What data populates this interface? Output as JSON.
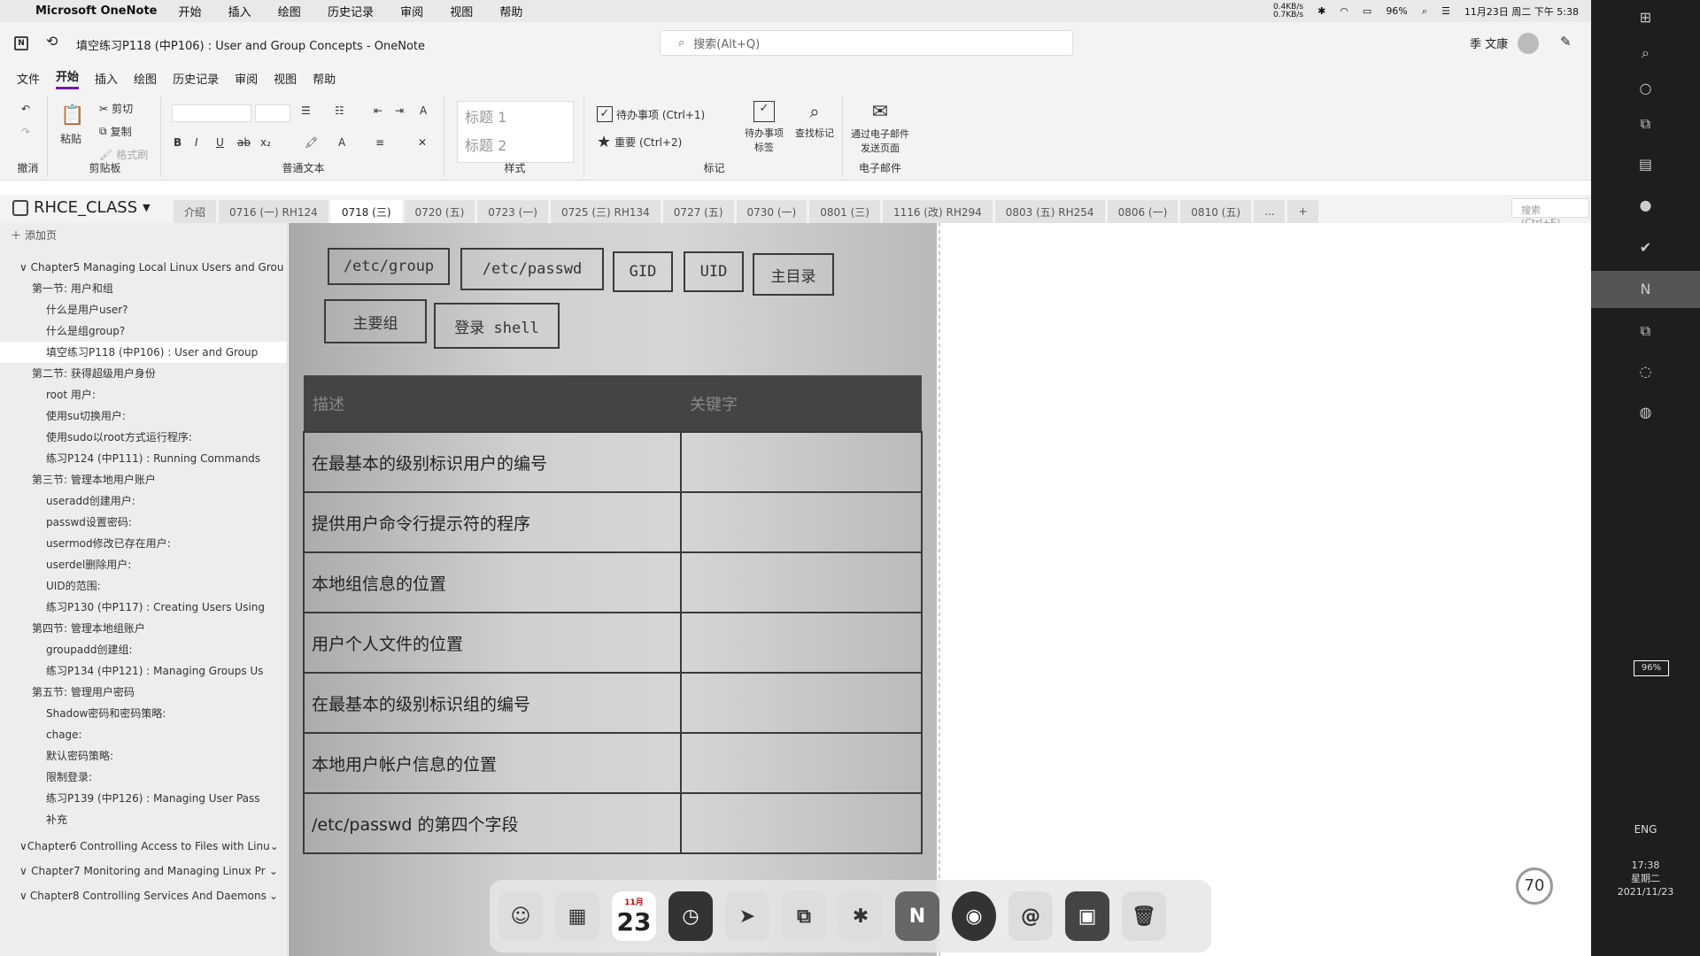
{
  "macbar": {
    "app_name": "Microsoft OneNote",
    "menus": [
      "开始",
      "插入",
      "绘图",
      "历史记录",
      "审阅",
      "视图",
      "帮助"
    ],
    "net_up": "0.4KB/s",
    "net_down": "0.7KB/s",
    "battery": "96%",
    "datetime": "11月23日 周二 下午 5:38"
  },
  "titlebar": {
    "doc_title": "填空练习P118 (中P106) :  User and Group Concepts  -  OneNote",
    "search_placeholder": "搜索(Alt+Q)",
    "user_name": "季 文康"
  },
  "ribbon_tabs": [
    "文件",
    "开始",
    "插入",
    "绘图",
    "历史记录",
    "审阅",
    "视图",
    "帮助"
  ],
  "ribbon": {
    "undo_group": "撤消",
    "paste": "粘贴",
    "cut": "剪切",
    "copy": "复制",
    "format_painter": "格式刷",
    "clipboard_group": "剪贴板",
    "basic_text_group": "普通文本",
    "heading1": "标题 1",
    "heading2": "标题 2",
    "styles_group": "样式",
    "todo": "待办事项 (Ctrl+1)",
    "important": "重要 (Ctrl+2)",
    "todo_tag": "待办事项标签",
    "find_tags": "查找标记",
    "tags_group": "标记",
    "email_page": "通过电子邮件发送页面",
    "email_group": "电子邮件"
  },
  "notebook": {
    "name": "RHCE_CLASS",
    "tab_search": "搜索(Ctrl+E)",
    "sections": [
      {
        "label": "介绍",
        "active": false
      },
      {
        "label": "0716 (一) RH124",
        "active": false
      },
      {
        "label": "0718 (三)",
        "active": true
      },
      {
        "label": "0720 (五)",
        "active": false
      },
      {
        "label": "0723 (一)",
        "active": false
      },
      {
        "label": "0725 (三) RH134",
        "active": false
      },
      {
        "label": "0727 (五)",
        "active": false
      },
      {
        "label": "0730 (一)",
        "active": false
      },
      {
        "label": "0801 (三)",
        "active": false
      },
      {
        "label": "1116 (改) RH294",
        "active": false
      },
      {
        "label": "0803 (五) RH254",
        "active": false
      },
      {
        "label": "0806 (一)",
        "active": false
      },
      {
        "label": "0810 (五)",
        "active": false
      },
      {
        "label": "...",
        "active": false
      },
      {
        "label": "+",
        "active": false
      }
    ]
  },
  "sidebar": {
    "add_page": "添加页",
    "pages": [
      {
        "label": "Chapter5 Managing Local Linux Users and Grou",
        "level": "lv1",
        "sel": false
      },
      {
        "label": "第一节: 用户和组",
        "level": "lv2",
        "sel": false
      },
      {
        "label": "什么是用户user?",
        "level": "lv3",
        "sel": false
      },
      {
        "label": "什么是组group?",
        "level": "lv3",
        "sel": false
      },
      {
        "label": "填空练习P118 (中P106) :  User and Group",
        "level": "lv3",
        "sel": true
      },
      {
        "label": "第二节: 获得超级用户身份",
        "level": "lv2",
        "sel": false
      },
      {
        "label": "root 用户:",
        "level": "lv3",
        "sel": false
      },
      {
        "label": "使用su切换用户:",
        "level": "lv3",
        "sel": false
      },
      {
        "label": "使用sudo以root方式运行程序:",
        "level": "lv3",
        "sel": false
      },
      {
        "label": "练习P124 (中P111) :  Running Commands",
        "level": "lv3",
        "sel": false
      },
      {
        "label": "第三节: 管理本地用户账户",
        "level": "lv2",
        "sel": false
      },
      {
        "label": "useradd创建用户:",
        "level": "lv3",
        "sel": false
      },
      {
        "label": "passwd设置密码:",
        "level": "lv3",
        "sel": false
      },
      {
        "label": "usermod修改已存在用户:",
        "level": "lv3",
        "sel": false
      },
      {
        "label": "userdel删除用户:",
        "level": "lv3",
        "sel": false
      },
      {
        "label": "UID的范围:",
        "level": "lv3",
        "sel": false
      },
      {
        "label": "练习P130 (中P117) :  Creating Users Using",
        "level": "lv3",
        "sel": false
      },
      {
        "label": "第四节: 管理本地组账户",
        "level": "lv2",
        "sel": false
      },
      {
        "label": "groupadd创建组:",
        "level": "lv3",
        "sel": false
      },
      {
        "label": "练习P134 (中P121) :  Managing Groups Us",
        "level": "lv3",
        "sel": false
      },
      {
        "label": "第五节: 管理用户密码",
        "level": "lv2",
        "sel": false
      },
      {
        "label": "Shadow密码和密码策略:",
        "level": "lv3",
        "sel": false
      },
      {
        "label": "chage:",
        "level": "lv3",
        "sel": false
      },
      {
        "label": "默认密码策略:",
        "level": "lv3",
        "sel": false
      },
      {
        "label": "限制登录:",
        "level": "lv3",
        "sel": false
      },
      {
        "label": "练习P139 (中P126) :  Managing User Pass",
        "level": "lv3",
        "sel": false
      },
      {
        "label": "补充",
        "level": "lv3",
        "sel": false
      }
    ],
    "chapters": [
      "Chapter6 Controlling Access to Files with Linu",
      "Chapter7 Monitoring and Managing Linux Pr",
      "Chapter8 Controlling Services And Daemons"
    ]
  },
  "worksheet": {
    "keywords": [
      "/etc/group",
      "/etc/passwd",
      "GID",
      "UID",
      "主目录",
      "主要组",
      "登录 shell"
    ],
    "table_header": [
      "描述",
      "关键字"
    ],
    "rows": [
      "在最基本的级别标识用户的编号",
      "提供用户命令行提示符的程序",
      "本地组信息的位置",
      "用户个人文件的位置",
      "在最基本的级别标识组的编号",
      "本地用户帐户信息的位置",
      "/etc/passwd 的第四个字段"
    ]
  },
  "dock": {
    "calendar_month": "11月",
    "calendar_day": "23"
  },
  "windows_taskbar": {
    "battery": "96%",
    "lang": "ENG",
    "time": "17:38",
    "weekday": "星期二",
    "date": "2021/11/23",
    "gauge": "70"
  }
}
